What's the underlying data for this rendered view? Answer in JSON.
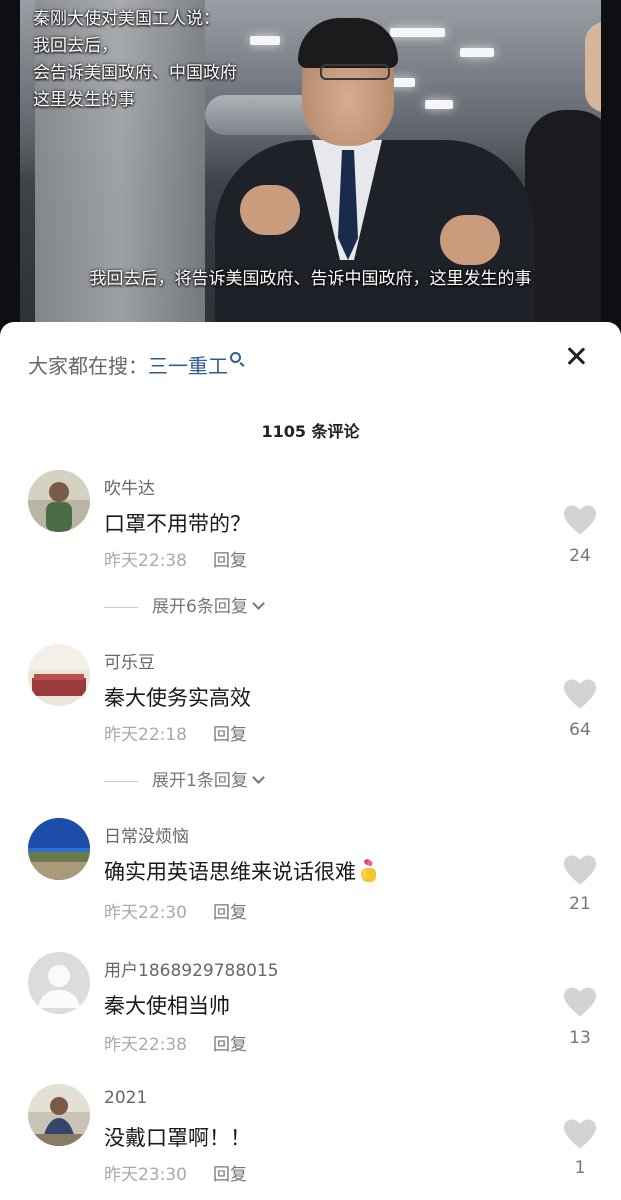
{
  "video": {
    "overlay_title_lines": [
      "秦刚大使对美国工人说：",
      "我回去后，",
      "会告诉美国政府、中国政府",
      "这里发生的事"
    ],
    "subtitle": "我回去后，将告诉美国政府、告诉中国政府，这里发生的事"
  },
  "search": {
    "label": "大家都在搜：",
    "term": "三一重工",
    "icon": "search-icon"
  },
  "close_icon": "close-icon",
  "comment_count": "1105 条评论",
  "comments": [
    {
      "user": "吹牛达",
      "text": "口罩不用带的？",
      "time": "昨天22:38",
      "reply": "回复",
      "likes": "24",
      "expand": "展开6条回复",
      "avatar_color": "#6a6f5c"
    },
    {
      "user": "可乐豆",
      "text": "秦大使务实高效",
      "time": "昨天22:18",
      "reply": "回复",
      "likes": "64",
      "expand": "展开1条回复",
      "avatar_color": "#9b3a3a"
    },
    {
      "user": "日常没烦恼",
      "text": "确实用英语思维来说话很难",
      "emoji": "🫰",
      "time": "昨天22:30",
      "reply": "回复",
      "likes": "21",
      "avatar_color": "#3f79c9"
    },
    {
      "user": "用户1868929788015",
      "text": "秦大使相当帅",
      "time": "昨天22:38",
      "reply": "回复",
      "likes": "13",
      "avatar_color": "#d8d8d8"
    },
    {
      "user": "2021",
      "text": "没戴口罩啊！！",
      "time": "昨天23:30",
      "reply": "回复",
      "likes": "1",
      "avatar_color": "#5b6b85"
    }
  ],
  "like_icon": "heart-icon"
}
